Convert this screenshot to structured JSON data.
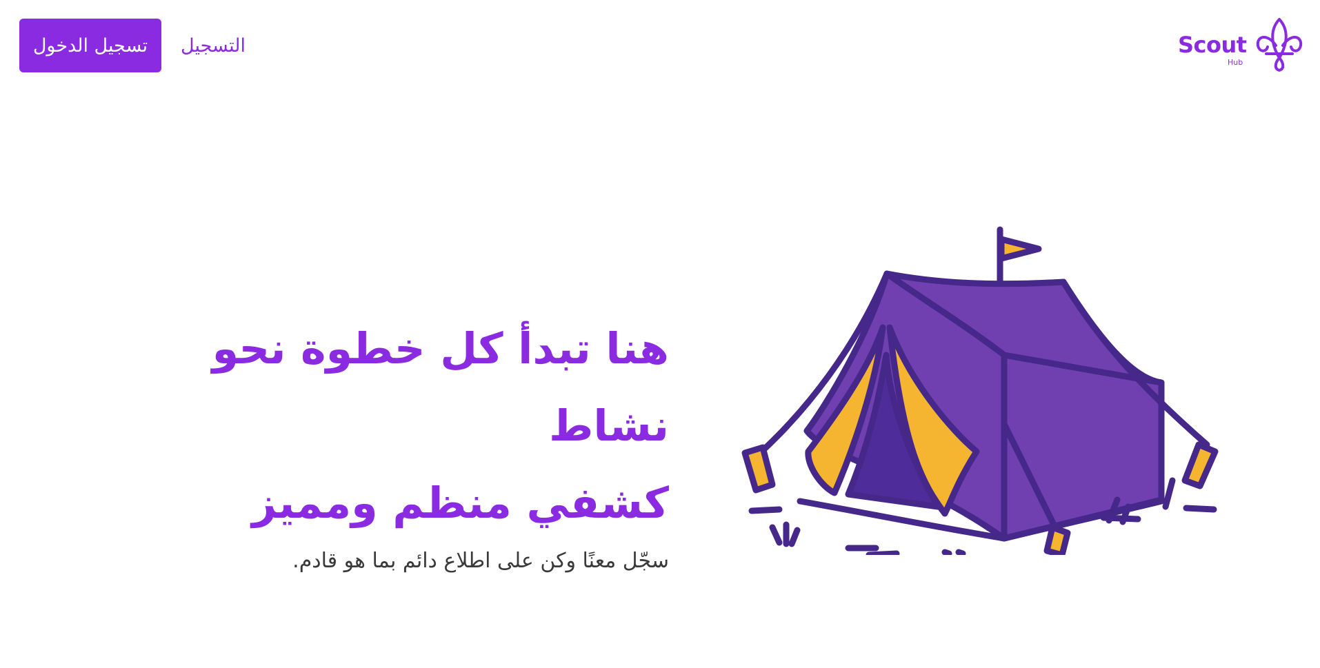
{
  "header": {
    "login_label": "تسجيل الدخول",
    "register_label": "التسجيل",
    "logo": {
      "word": "Scout",
      "sub": "Hub",
      "icon": "fleur-de-lis-icon"
    }
  },
  "hero": {
    "title_line1": "هنا تبدأ كل خطوة نحو نشاط",
    "title_line2": "كشفي منظم ومميز",
    "subtitle": "سجّل معنًا وكن على اطلاع دائم بما هو قادم.",
    "illustration": "tent-illustration"
  },
  "colors": {
    "accent": "#8a2be2",
    "tent_body": "#7040b0",
    "tent_outline": "#45288a",
    "tent_inner": "#f5b531",
    "text_dark": "#3a3a3a"
  }
}
